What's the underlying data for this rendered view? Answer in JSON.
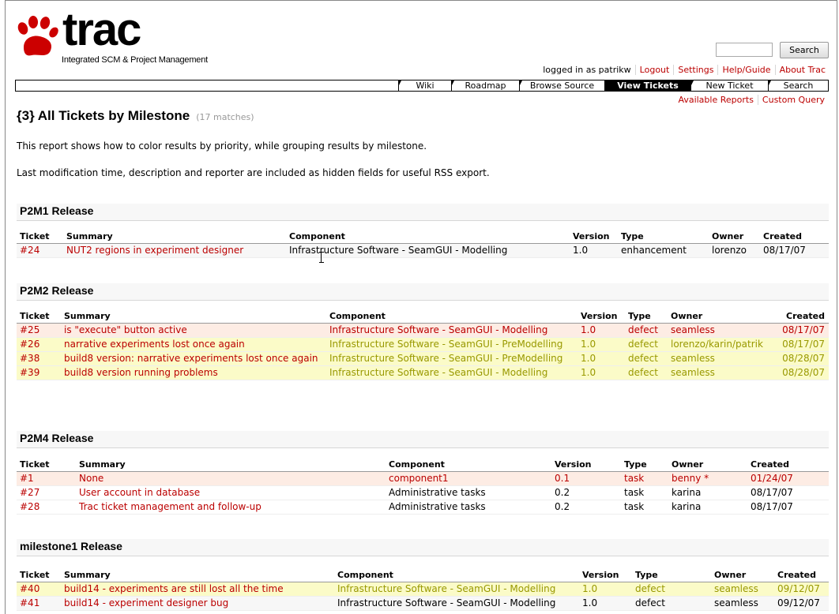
{
  "logo": {
    "word": "trac",
    "tagline": "Integrated SCM & Project Management"
  },
  "search": {
    "button_label": "Search",
    "placeholder": ""
  },
  "metanav": {
    "logged_in": "logged in as patrikw",
    "logout": "Logout",
    "settings": "Settings",
    "help": "Help/Guide",
    "about": "About Trac"
  },
  "mainnav": {
    "wiki": "Wiki",
    "roadmap": "Roadmap",
    "browse": "Browse Source",
    "view_tickets": "View Tickets",
    "new_ticket": "New Ticket",
    "search": "Search"
  },
  "ctxnav": {
    "available_reports": "Available Reports",
    "custom_query": "Custom Query"
  },
  "page": {
    "title": "{3} All Tickets by Milestone",
    "matches": "(17 matches)",
    "description1": "This report shows how to color results by priority, while grouping results by milestone.",
    "description2": "Last modification time, description and reporter are included as hidden fields for useful RSS export."
  },
  "columns": {
    "ticket": "Ticket",
    "summary": "Summary",
    "component": "Component",
    "version": "Version",
    "type": "Type",
    "owner": "Owner",
    "created": "Created"
  },
  "groups": [
    {
      "title": "P2M1 Release",
      "rows": [
        {
          "ticket": "#24",
          "summary": "NUT2 regions in experiment designer",
          "component": "Infrastructure Software - SeamGUI - Modelling",
          "version": "1.0",
          "type": "enhancement",
          "owner": "lorenzo",
          "created": "08/17/07"
        }
      ]
    },
    {
      "title": "P2M2 Release",
      "rows": [
        {
          "ticket": "#25",
          "summary": "is \"execute\" button active",
          "component": "Infrastructure Software - SeamGUI - Modelling",
          "version": "1.0",
          "type": "defect",
          "owner": "seamless",
          "created": "08/17/07"
        },
        {
          "ticket": "#26",
          "summary": "narrative experiments lost once again",
          "component": "Infrastructure Software - SeamGUI - PreModelling",
          "version": "1.0",
          "type": "defect",
          "owner": "lorenzo/karin/patrik",
          "created": "08/17/07"
        },
        {
          "ticket": "#38",
          "summary": "build8 version: narrative experiments lost once again",
          "component": "Infrastructure Software - SeamGUI - PreModelling",
          "version": "1.0",
          "type": "defect",
          "owner": "seamless",
          "created": "08/28/07"
        },
        {
          "ticket": "#39",
          "summary": "build8 version running problems",
          "component": "Infrastructure Software - SeamGUI - Modelling",
          "version": "1.0",
          "type": "defect",
          "owner": "seamless",
          "created": "08/28/07"
        }
      ]
    },
    {
      "title": "P2M4 Release",
      "rows": [
        {
          "ticket": "#1",
          "summary": "None",
          "component": "component1",
          "version": "0.1",
          "type": "task",
          "owner": "benny *",
          "created": "01/24/07"
        },
        {
          "ticket": "#27",
          "summary": "User account in database",
          "component": "Administrative tasks",
          "version": "0.2",
          "type": "task",
          "owner": "karina",
          "created": "08/17/07"
        },
        {
          "ticket": "#28",
          "summary": "Trac ticket management and follow-up",
          "component": "Administrative tasks",
          "version": "0.2",
          "type": "task",
          "owner": "karina",
          "created": "08/17/07"
        }
      ]
    },
    {
      "title": "milestone1 Release",
      "rows": [
        {
          "ticket": "#40",
          "summary": "build14 - experiments are still lost all the time",
          "component": "Infrastructure Software - SeamGUI - Modelling",
          "version": "1.0",
          "type": "defect",
          "owner": "seamless",
          "created": "09/12/07"
        },
        {
          "ticket": "#41",
          "summary": "build14 - experiment designer bug",
          "component": "Infrastructure Software - SeamGUI - Modelling",
          "version": "1.0",
          "type": "defect",
          "owner": "seamless",
          "created": "09/12/07"
        }
      ]
    }
  ]
}
